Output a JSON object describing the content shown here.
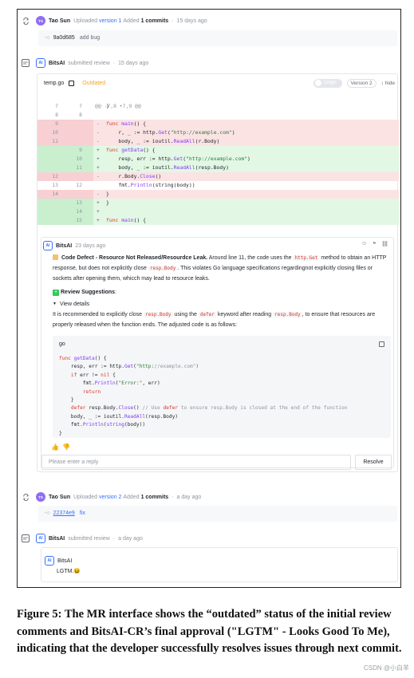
{
  "events": {
    "first_upload": {
      "author": "Tao Sun",
      "avatar_initials": "TS",
      "action": "Uploaded",
      "version": "version 1",
      "added": "Added",
      "commits": "1 commits",
      "time": "15 days ago",
      "commit_hash": "9a0d685",
      "commit_msg": "add bug"
    },
    "first_review": {
      "author": "BitsAI",
      "avatar_initials": "AI",
      "action": "submitted review",
      "time": "15 days ago"
    },
    "second_upload": {
      "author": "Tao Sun",
      "avatar_initials": "TS",
      "action": "Uploaded",
      "version": "version 2",
      "added": "Added",
      "commits": "1 commits",
      "time": "a day ago",
      "commit_hash": "22374e9",
      "commit_msg": "fix"
    },
    "second_review": {
      "author": "BitsAI",
      "avatar_initials": "AI",
      "action": "submitted review",
      "time": "a day ago",
      "comment": "LGTM.",
      "emoji": "😆"
    }
  },
  "file_card": {
    "filename": "temp.go",
    "status": "Outdated",
    "toggle_label": "Origin",
    "version": "Version 2",
    "hide": "hide",
    "status_color": "#f5a623"
  },
  "diff": {
    "hunk": "@@ -7,8 +7,9 @@",
    "lines": [
      {
        "old": "7",
        "new": "7",
        "sign": "",
        "type": "ctx",
        "code": ")"
      },
      {
        "old": "8",
        "new": "8",
        "sign": "",
        "type": "ctx",
        "code": ""
      },
      {
        "old": "9",
        "new": "",
        "sign": "-",
        "type": "del",
        "code": "func main() {"
      },
      {
        "old": "10",
        "new": "",
        "sign": "-",
        "type": "del",
        "code": "    r, _ := http.Get(\"http://example.com\")"
      },
      {
        "old": "11",
        "new": "",
        "sign": "-",
        "type": "del",
        "code": "    body, _ := ioutil.ReadAll(r.Body)"
      },
      {
        "old": "",
        "new": "9",
        "sign": "+",
        "type": "add",
        "code": "func getData() {"
      },
      {
        "old": "",
        "new": "10",
        "sign": "+",
        "type": "add",
        "code": "    resp, err := http.Get(\"http://example.com\")"
      },
      {
        "old": "",
        "new": "11",
        "sign": "+",
        "type": "add",
        "code": "    body, _ := ioutil.ReadAll(resp.Body)"
      },
      {
        "old": "12",
        "new": "",
        "sign": "-",
        "type": "del",
        "code": "    r.Body.Close()"
      },
      {
        "old": "13",
        "new": "12",
        "sign": "",
        "type": "ctx",
        "code": "    fmt.Println(string(body))"
      },
      {
        "old": "14",
        "new": "",
        "sign": "-",
        "type": "del",
        "code": "}"
      },
      {
        "old": "",
        "new": "13",
        "sign": "+",
        "type": "add",
        "code": "}"
      },
      {
        "old": "",
        "new": "14",
        "sign": "+",
        "type": "add",
        "code": ""
      },
      {
        "old": "",
        "new": "15",
        "sign": "+",
        "type": "add",
        "code": "func main() {"
      }
    ]
  },
  "comment": {
    "author": "BitsAI",
    "time": "23 days ago",
    "defect_title": "Code Defect - Resource Not Released/Resourdce Leak.",
    "defect_p1": "Around line 11, the code uses the",
    "defect_code1": "http.Get",
    "defect_p2": "method to obtain an HTTP response, but does not explicitly close",
    "defect_code2": "resp.Body",
    "defect_p3": ". This violates Go language specifications regardingnot explicitly closing files or sockets after opening them, whicch may lead to resource leaks.",
    "suggestion_title": "Review Suggestions",
    "view_details": "View details",
    "sugg_p1": "It is recommended to explicitly close",
    "sugg_code1": "resp.Body",
    "sugg_p2": "using the",
    "sugg_code2": "defer",
    "sugg_p3": "keyword after reading",
    "sugg_code3": "resp.Body",
    "sugg_p4": ", to ensure that resources are properly released when the function ends. The adjusted code is as follows:",
    "lang": "go",
    "snippet": [
      "func getData() {",
      "    resp, err := http.Get(\"http://example.com\")",
      "    if err != nil {",
      "        fmt.Println(\"Error:\", err)",
      "        return",
      "    }",
      "    defer resp.Body.Close() // Use defer to ensure resp.Body is closed at the end of the function",
      "    body, _ := ioutil.ReadAll(resp.Body)",
      "    fmt.Println(string(body))",
      "}"
    ],
    "reply_placeholder": "Please enter a reply",
    "resolve": "Resolve"
  },
  "caption": {
    "text": "Figure 5: The MR interface shows the “outdated” status of the initial review comments and BitsAI-CR’s final approval (\"LGTM\" - Looks Good To Me), indicating that the developer successfully resolves issues through next commit.",
    "watermark": "CSDN @小白羊"
  }
}
